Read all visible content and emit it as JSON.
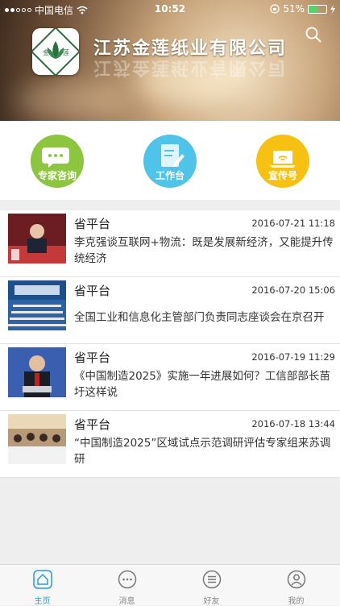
{
  "status_bar": {
    "carrier": "中国电信",
    "time": "10:52",
    "battery": "51%"
  },
  "header": {
    "company_name": "江苏金莲纸业有限公司",
    "logo_text_left": "金",
    "logo_text_right": "莲"
  },
  "quick_actions": [
    {
      "label": "专家咨询",
      "color": "#8cc63f"
    },
    {
      "label": "工作台",
      "color": "#4fc3e8"
    },
    {
      "label": "宣传号",
      "color": "#f7c114"
    }
  ],
  "news": [
    {
      "source": "省平台",
      "date": "2016-07-21 11:18",
      "title": "李克强谈互联网+物流：既是发展新经济，又能提升传统经济"
    },
    {
      "source": "省平台",
      "date": "2016-07-20 15:06",
      "title": "全国工业和信息化主管部门负责同志座谈会在京召开"
    },
    {
      "source": "省平台",
      "date": "2016-07-19 11:29",
      "title": "《中国制造2025》实施一年进展如何？工信部部长苗圩这样说"
    },
    {
      "source": "省平台",
      "date": "2016-07-18 13:44",
      "title": "“中国制造2025”区域试点示范调研评估专家组来苏调研"
    }
  ],
  "tabs": [
    {
      "label": "主页"
    },
    {
      "label": "消息"
    },
    {
      "label": "好友"
    },
    {
      "label": "我的"
    }
  ],
  "colors": {
    "accent": "#2a9ad8"
  }
}
